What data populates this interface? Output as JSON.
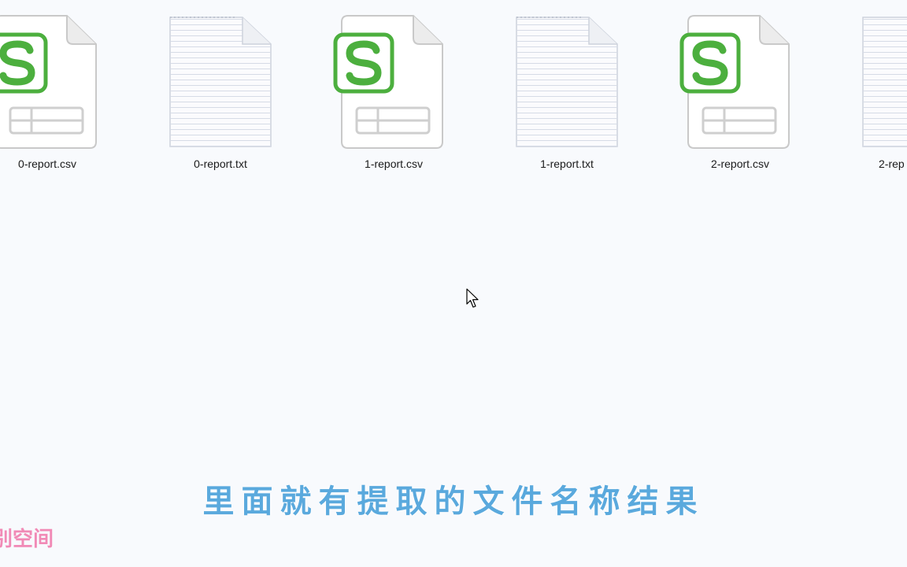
{
  "files": [
    {
      "name": "0-report.csv",
      "type": "csv",
      "icon": "spreadsheet-file-icon"
    },
    {
      "name": "0-report.txt",
      "type": "txt",
      "icon": "text-file-icon"
    },
    {
      "name": "1-report.csv",
      "type": "csv",
      "icon": "spreadsheet-file-icon"
    },
    {
      "name": "1-report.txt",
      "type": "txt",
      "icon": "text-file-icon"
    },
    {
      "name": "2-report.csv",
      "type": "csv",
      "icon": "spreadsheet-file-icon"
    },
    {
      "name": "2-rep",
      "type": "txt",
      "icon": "text-file-icon"
    }
  ],
  "subtitle": "里面就有提取的文件名称结果",
  "watermark": "别空间",
  "colors": {
    "background": "#f8fafd",
    "spreadsheet_green": "#4caf3e",
    "subtitle_blue": "#5aa9dd",
    "watermark_pink": "#f06fa5"
  }
}
